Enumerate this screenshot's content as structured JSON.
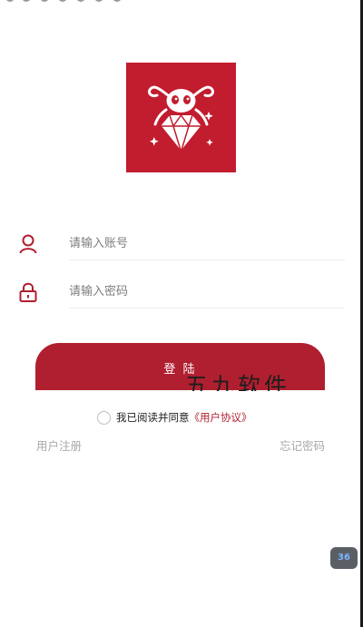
{
  "login": {
    "account_placeholder": "请输入账号",
    "password_placeholder": "请输入密码",
    "button_label": "登 陆",
    "agree_text": "我已阅读并同意",
    "agreement_link": "《用户协议》",
    "register_label": "用户注册",
    "forgot_label": "忘记密码"
  },
  "overlay": {
    "watermark_text": "五九软件",
    "badge_text": "36"
  },
  "colors": {
    "brand": "#c21c2f",
    "button": "#b01f30",
    "muted": "#a8a8a8"
  },
  "icons": {
    "account": "user-icon",
    "password": "lock-icon",
    "logo": "ant-diamond-logo"
  }
}
